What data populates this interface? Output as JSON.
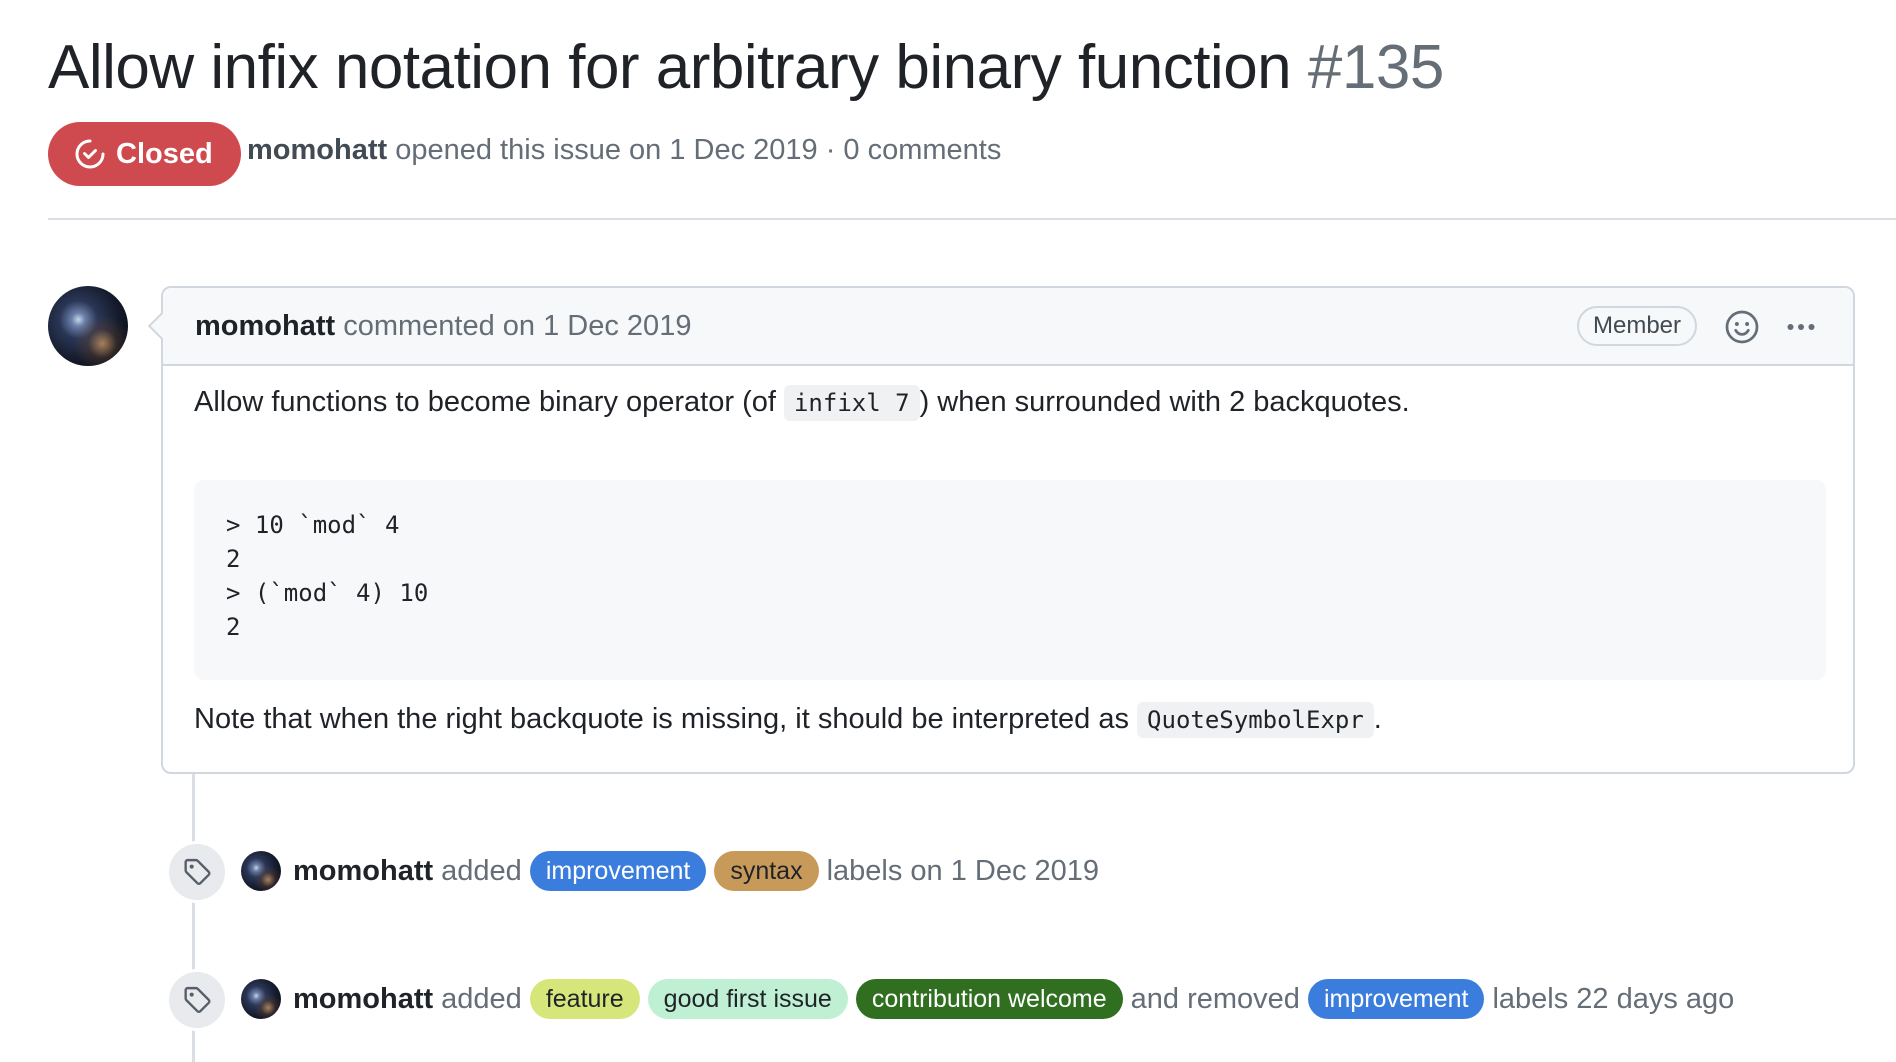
{
  "issue": {
    "title": "Allow infix notation for arbitrary binary function",
    "number": "#135",
    "status": "Closed",
    "author": "momohatt",
    "meta_rest": "opened this issue on 1 Dec 2019 · 0 comments"
  },
  "comment": {
    "author": "momohatt",
    "action": "commented on 1 Dec 2019",
    "role_badge": "Member",
    "body_intro": "Allow functions to become binary operator (of",
    "body_code": "infixl 7",
    "body_after": ") when surrounded with 2 backquotes.",
    "code_lines": [
      "> 10 `mod` 4",
      "2",
      "> (`mod` 4) 10",
      "2"
    ],
    "note_intro": "Note that when the right backquote is missing, it should be interpreted as",
    "note_code": "QuoteSymbolExpr",
    "note_after": "."
  },
  "events": [
    {
      "author": "momohatt",
      "verb": "added",
      "labels": [
        {
          "name": "improvement",
          "bg": "#3b7ddd",
          "fg": "#ffffff"
        },
        {
          "name": "syntax",
          "bg": "#c89a5a",
          "fg": "#1f2328"
        }
      ],
      "suffix": "labels on 1 Dec 2019"
    },
    {
      "author": "momohatt",
      "verb": "added",
      "labels": [
        {
          "name": "feature",
          "bg": "#d7e67a",
          "fg": "#1f2328"
        },
        {
          "name": "good first issue",
          "bg": "#bff0d4",
          "fg": "#1f2328"
        },
        {
          "name": "contribution welcome",
          "bg": "#2f6f1f",
          "fg": "#ffffff"
        }
      ],
      "middle": "and removed",
      "removed_labels": [
        {
          "name": "improvement",
          "bg": "#3b7ddd",
          "fg": "#ffffff"
        }
      ],
      "suffix": "labels 22 days ago"
    }
  ],
  "colors": {
    "closed": "#cf4a4f",
    "border": "#d0d7de",
    "muted_text": "#656d76"
  },
  "icons": {
    "status": "issue-closed-icon",
    "reactions": "smiley-icon",
    "menu": "kebab-horizontal-icon",
    "event": "tag-icon"
  }
}
